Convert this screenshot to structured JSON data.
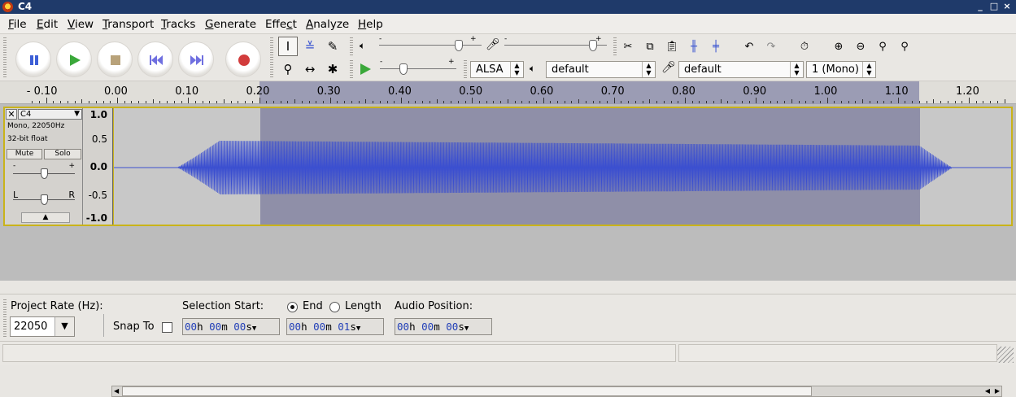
{
  "window": {
    "title": "C4"
  },
  "menu": [
    "File",
    "Edit",
    "View",
    "Transport",
    "Tracks",
    "Generate",
    "Effect",
    "Analyze",
    "Help"
  ],
  "menu_access": [
    "F",
    "E",
    "V",
    "T",
    "T",
    "G",
    "c",
    "A",
    "H"
  ],
  "transport": {
    "pause": "pause-icon",
    "play": "play-icon",
    "stop": "stop-icon",
    "skip_start": "skip-start-icon",
    "skip_end": "skip-end-icon",
    "record": "record-icon"
  },
  "meter": {
    "playback_scale_start": "-",
    "playback_scale_end": "+",
    "record_scale_start": "-",
    "record_scale_end": "+",
    "playback_volume": 0.8,
    "record_volume": 0.9,
    "play_speed": 0.28
  },
  "device": {
    "host": "ALSA",
    "output": "default",
    "input": "default",
    "channels": "1 (Mono)"
  },
  "ruler": {
    "labels": [
      "- 0.10",
      "0.00",
      "0.10",
      "0.20",
      "0.30",
      "0.40",
      "0.50",
      "0.60",
      "0.70",
      "0.80",
      "0.90",
      "1.00",
      "1.10",
      "1.20"
    ]
  },
  "track": {
    "name": "C4",
    "info1": "Mono, 22050Hz",
    "info2": "32-bit float",
    "mute": "Mute",
    "solo": "Solo",
    "gain_minus": "-",
    "gain_plus": "+",
    "pan_left": "L",
    "pan_right": "R",
    "gain_level": 0.5,
    "pan_level": 0.5,
    "scale": [
      "1.0",
      "0.5",
      "0.0",
      "-0.5",
      "-1.0"
    ]
  },
  "selection": {
    "start_seconds": 0.2,
    "end_seconds": 1.13
  },
  "selection_bar": {
    "project_rate_label": "Project Rate (Hz):",
    "project_rate": "22050",
    "snap_to_label": "Snap To",
    "snap_to_checked": false,
    "selection_start_label": "Selection Start:",
    "end_label": "End",
    "length_label": "Length",
    "end_selected": true,
    "audio_position_label": "Audio Position:",
    "selection_start": {
      "hh": "00",
      "mm": "00",
      "ss": "00"
    },
    "selection_end": {
      "hh": "00",
      "mm": "00",
      "ss": "01"
    },
    "audio_position": {
      "hh": "00",
      "mm": "00",
      "ss": "00"
    },
    "unit_h": "h",
    "unit_m": "m",
    "unit_s": "s"
  },
  "status": {
    "left": "",
    "right": ""
  },
  "colors": {
    "titlebar": "#1f3a6a",
    "waveform": "#3b4fd0",
    "selection": "#8f8fa8",
    "track_border": "#c9b31a"
  }
}
